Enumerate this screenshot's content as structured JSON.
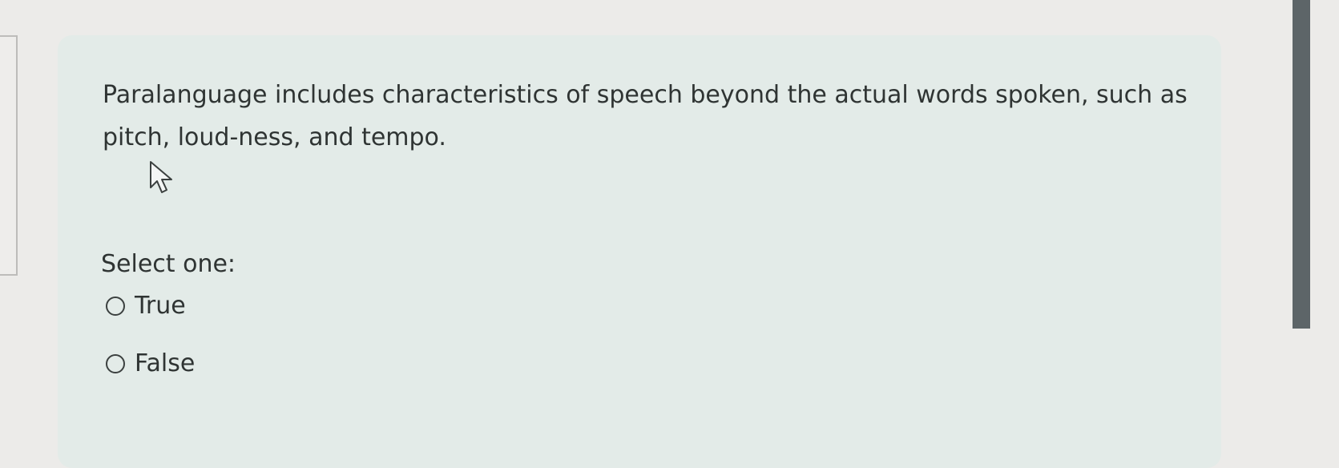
{
  "question": {
    "text": "Paralanguage includes characteristics of speech beyond the actual words spoken, such as pitch, loud-ness, and tempo.",
    "prompt": "Select one:",
    "options": [
      {
        "label": "True",
        "selected": false
      },
      {
        "label": "False",
        "selected": false
      }
    ]
  },
  "icons": {
    "cursor": "mouse-pointer-icon",
    "radio": "radio-button-icon"
  },
  "colors": {
    "card_background": "#e3ebe8",
    "page_background": "#ecebe9",
    "text": "#2f3433",
    "scrollbar": "#5d6568"
  }
}
